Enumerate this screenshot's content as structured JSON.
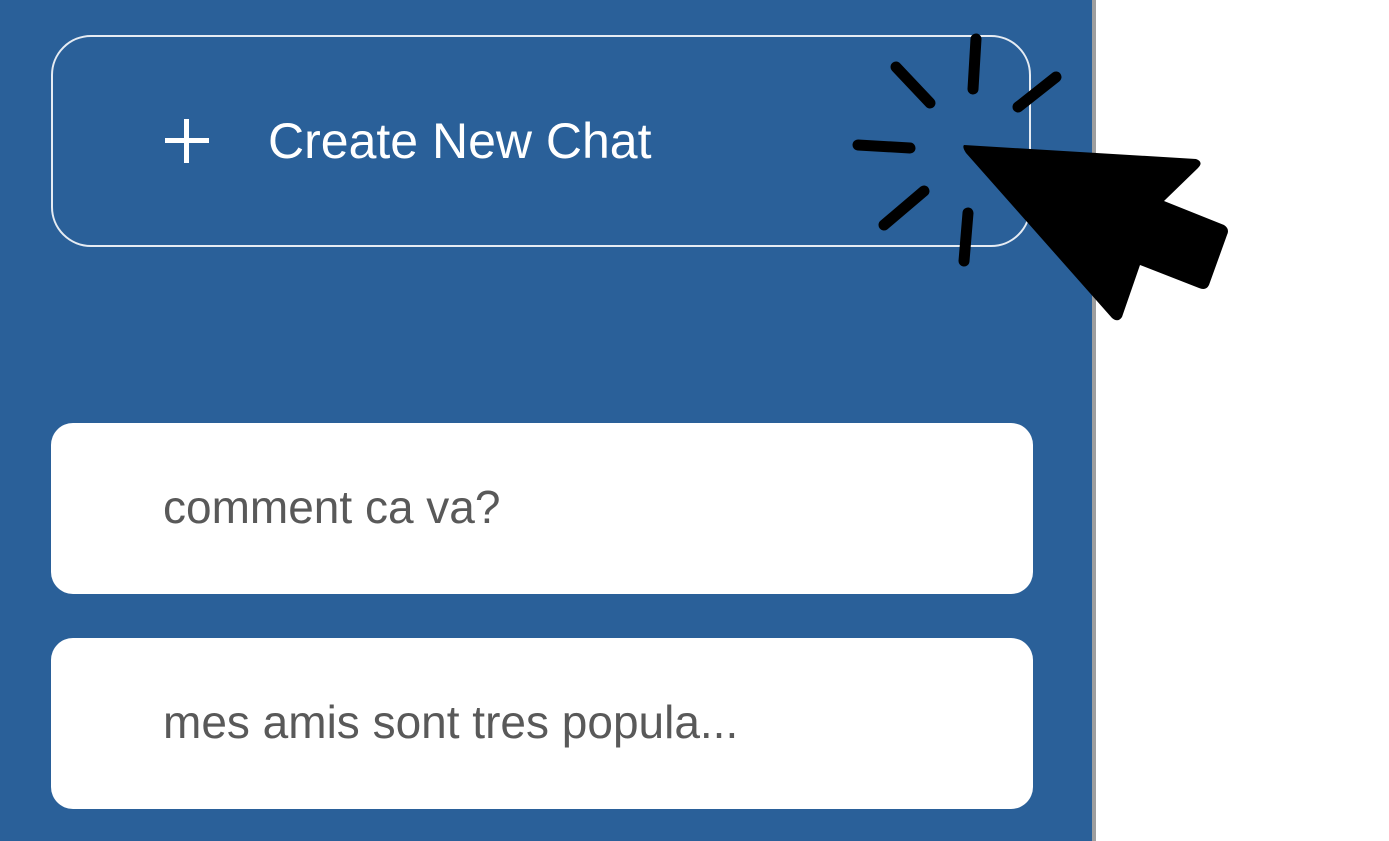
{
  "sidebar": {
    "new_chat_button": {
      "label": "Create New Chat",
      "icon": "plus-icon"
    },
    "history": [
      {
        "label": "comment ca va?"
      },
      {
        "label": "mes amis sont tres popula..."
      }
    ]
  },
  "overlay": {
    "icon": "click-cursor-icon"
  },
  "colors": {
    "sidebar_background": "#2a6099",
    "button_border": "#e6ecf3",
    "history_item_background": "#ffffff",
    "history_item_text": "#595959",
    "divider": "#9e9e9e"
  }
}
